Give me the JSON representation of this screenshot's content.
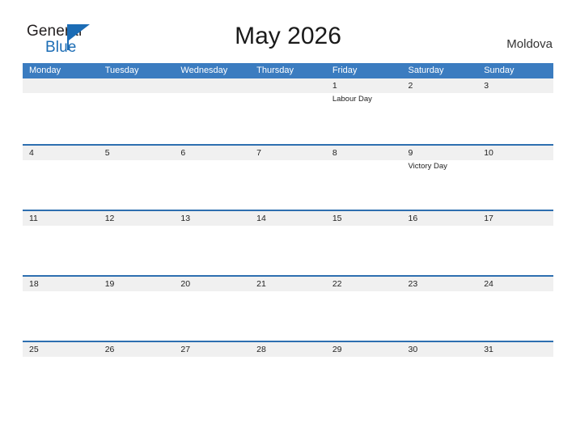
{
  "brand": {
    "name_part1": "General",
    "name_part2": "Blue",
    "flag_icon": "blue-triangle-flag-icon",
    "primary_color": "#1b6cb5"
  },
  "header": {
    "title": "May 2026",
    "country": "Moldova"
  },
  "colors": {
    "header_bar": "#3b7cc0",
    "row_rule": "#2e6fb0",
    "date_band": "#f0f0f0",
    "text": "#222222"
  },
  "calendar": {
    "month": "May",
    "year": "2026",
    "weekday_headers": [
      "Monday",
      "Tuesday",
      "Wednesday",
      "Thursday",
      "Friday",
      "Saturday",
      "Sunday"
    ],
    "weeks": [
      {
        "days": [
          {
            "num": "",
            "events": []
          },
          {
            "num": "",
            "events": []
          },
          {
            "num": "",
            "events": []
          },
          {
            "num": "",
            "events": []
          },
          {
            "num": "1",
            "events": [
              "Labour Day"
            ]
          },
          {
            "num": "2",
            "events": []
          },
          {
            "num": "3",
            "events": []
          }
        ]
      },
      {
        "days": [
          {
            "num": "4",
            "events": []
          },
          {
            "num": "5",
            "events": []
          },
          {
            "num": "6",
            "events": []
          },
          {
            "num": "7",
            "events": []
          },
          {
            "num": "8",
            "events": []
          },
          {
            "num": "9",
            "events": [
              "Victory Day"
            ]
          },
          {
            "num": "10",
            "events": []
          }
        ]
      },
      {
        "days": [
          {
            "num": "11",
            "events": []
          },
          {
            "num": "12",
            "events": []
          },
          {
            "num": "13",
            "events": []
          },
          {
            "num": "14",
            "events": []
          },
          {
            "num": "15",
            "events": []
          },
          {
            "num": "16",
            "events": []
          },
          {
            "num": "17",
            "events": []
          }
        ]
      },
      {
        "days": [
          {
            "num": "18",
            "events": []
          },
          {
            "num": "19",
            "events": []
          },
          {
            "num": "20",
            "events": []
          },
          {
            "num": "21",
            "events": []
          },
          {
            "num": "22",
            "events": []
          },
          {
            "num": "23",
            "events": []
          },
          {
            "num": "24",
            "events": []
          }
        ]
      },
      {
        "days": [
          {
            "num": "25",
            "events": []
          },
          {
            "num": "26",
            "events": []
          },
          {
            "num": "27",
            "events": []
          },
          {
            "num": "28",
            "events": []
          },
          {
            "num": "29",
            "events": []
          },
          {
            "num": "30",
            "events": []
          },
          {
            "num": "31",
            "events": []
          }
        ]
      }
    ]
  }
}
